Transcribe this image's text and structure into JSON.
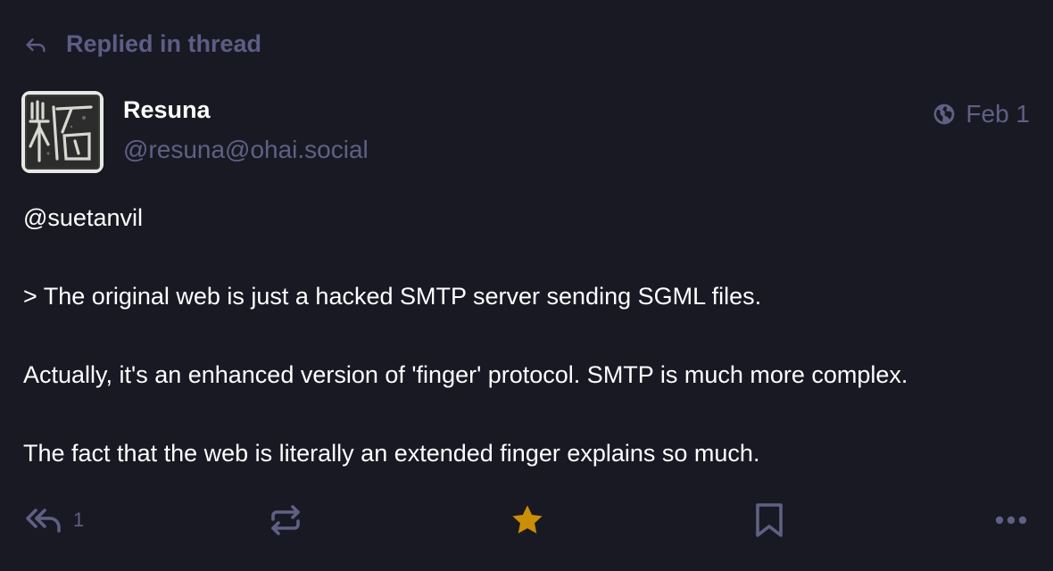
{
  "prepend": {
    "label": "Replied in thread",
    "icon": "reply-arrow-icon"
  },
  "account": {
    "display_name": "Resuna",
    "acct": "@resuna@ohai.social",
    "avatar_icon": "stone-rubbing-avatar"
  },
  "meta": {
    "visibility_icon": "globe-icon",
    "date": "Feb 1"
  },
  "content": {
    "paragraphs": [
      "@suetanvil",
      "> The original web is just a hacked SMTP server sending SGML files.",
      "Actually, it's an enhanced version of 'finger' protocol. SMTP is much more complex.",
      "The fact that the web is literally an extended finger explains so much."
    ]
  },
  "actions": {
    "reply_count": "1",
    "reply_icon": "reply-all-icon",
    "boost_icon": "boost-icon",
    "favourite_icon": "star-icon",
    "favourite_active": true,
    "bookmark_icon": "bookmark-icon",
    "more_icon": "more-icon"
  },
  "colors": {
    "background": "#191924",
    "muted": "#606084",
    "text": "#ffffff",
    "favourite": "#ca8f04"
  }
}
